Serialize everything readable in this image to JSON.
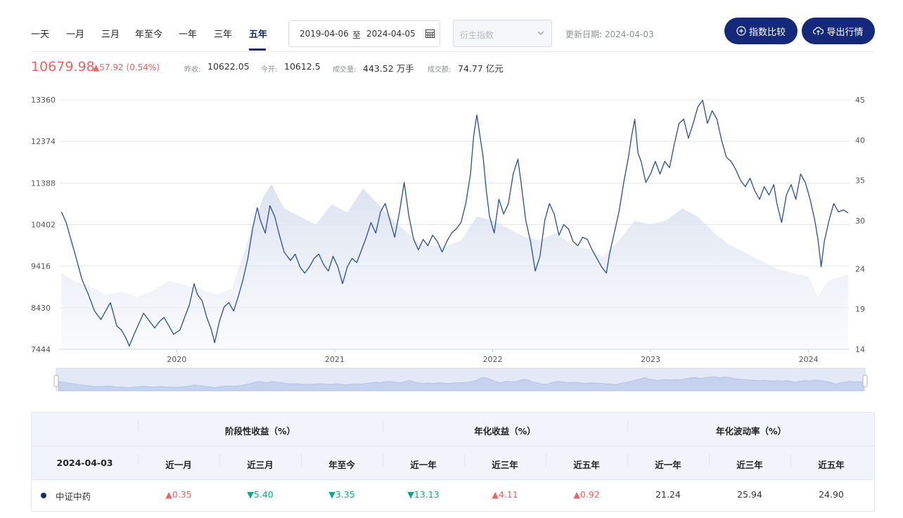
{
  "toolbar": {
    "periods": [
      "一天",
      "一月",
      "三月",
      "年至今",
      "一年",
      "三年",
      "五年"
    ],
    "active_period": "五年",
    "date_start": "2019-04-06",
    "date_sep": "至",
    "date_end": "2024-04-05",
    "derived_placeholder": "衍生指数",
    "update_label": "更新日期: 2024-04-03",
    "compare_button": "指数比较",
    "export_button": "导出行情"
  },
  "quote": {
    "price": "10679.98",
    "change": "▲57.92 (0.54%)",
    "prev_close_label": "昨收:",
    "prev_close": "10622.05",
    "open_label": "今开:",
    "open": "10612.5",
    "volume_label": "成交量:",
    "volume": "443.52 万手",
    "amount_label": "成交额:",
    "amount": "74.77 亿元"
  },
  "chart_data": {
    "type": "line",
    "x_ticks": [
      "2020",
      "2021",
      "2022",
      "2023",
      "2024"
    ],
    "y_left_ticks": [
      7444,
      8430,
      9416,
      10402,
      11388,
      12374,
      13360
    ],
    "y_left_range": [
      7444,
      13360
    ],
    "y_right_ticks": [
      14,
      19,
      24,
      30,
      35,
      40,
      45
    ],
    "y_right_range": [
      14,
      45
    ],
    "series": [
      {
        "kind": "line",
        "color": "#2a4e9c",
        "points": [
          [
            2019.27,
            10700
          ],
          [
            2019.3,
            10450
          ],
          [
            2019.33,
            10050
          ],
          [
            2019.36,
            9650
          ],
          [
            2019.4,
            9100
          ],
          [
            2019.44,
            8750
          ],
          [
            2019.48,
            8350
          ],
          [
            2019.52,
            8150
          ],
          [
            2019.55,
            8350
          ],
          [
            2019.58,
            8550
          ],
          [
            2019.62,
            8000
          ],
          [
            2019.65,
            7900
          ],
          [
            2019.68,
            7700
          ],
          [
            2019.7,
            7520
          ],
          [
            2019.73,
            7800
          ],
          [
            2019.76,
            8050
          ],
          [
            2019.79,
            8300
          ],
          [
            2019.82,
            8150
          ],
          [
            2019.86,
            7950
          ],
          [
            2019.89,
            8100
          ],
          [
            2019.92,
            8200
          ],
          [
            2019.95,
            8000
          ],
          [
            2019.98,
            7800
          ],
          [
            2020.02,
            7900
          ],
          [
            2020.05,
            8200
          ],
          [
            2020.08,
            8500
          ],
          [
            2020.11,
            9000
          ],
          [
            2020.13,
            8750
          ],
          [
            2020.16,
            8600
          ],
          [
            2020.19,
            8200
          ],
          [
            2020.22,
            7900
          ],
          [
            2020.24,
            7600
          ],
          [
            2020.27,
            8100
          ],
          [
            2020.3,
            8450
          ],
          [
            2020.33,
            8550
          ],
          [
            2020.36,
            8350
          ],
          [
            2020.39,
            8700
          ],
          [
            2020.42,
            9100
          ],
          [
            2020.45,
            9600
          ],
          [
            2020.48,
            10300
          ],
          [
            2020.51,
            10800
          ],
          [
            2020.53,
            10500
          ],
          [
            2020.56,
            10200
          ],
          [
            2020.59,
            10850
          ],
          [
            2020.62,
            10600
          ],
          [
            2020.65,
            10150
          ],
          [
            2020.68,
            9750
          ],
          [
            2020.72,
            9550
          ],
          [
            2020.75,
            9700
          ],
          [
            2020.78,
            9400
          ],
          [
            2020.81,
            9250
          ],
          [
            2020.84,
            9400
          ],
          [
            2020.87,
            9600
          ],
          [
            2020.9,
            9700
          ],
          [
            2020.93,
            9450
          ],
          [
            2020.96,
            9300
          ],
          [
            2020.99,
            9650
          ],
          [
            2021.02,
            9400
          ],
          [
            2021.05,
            9000
          ],
          [
            2021.08,
            9400
          ],
          [
            2021.11,
            9600
          ],
          [
            2021.14,
            9500
          ],
          [
            2021.17,
            9800
          ],
          [
            2021.2,
            10100
          ],
          [
            2021.23,
            10450
          ],
          [
            2021.26,
            10200
          ],
          [
            2021.29,
            10700
          ],
          [
            2021.32,
            10900
          ],
          [
            2021.35,
            10500
          ],
          [
            2021.38,
            10100
          ],
          [
            2021.41,
            10700
          ],
          [
            2021.44,
            11400
          ],
          [
            2021.47,
            10600
          ],
          [
            2021.5,
            10050
          ],
          [
            2021.53,
            9800
          ],
          [
            2021.56,
            10050
          ],
          [
            2021.59,
            9900
          ],
          [
            2021.62,
            10150
          ],
          [
            2021.65,
            10000
          ],
          [
            2021.68,
            9750
          ],
          [
            2021.71,
            10000
          ],
          [
            2021.74,
            10200
          ],
          [
            2021.77,
            10300
          ],
          [
            2021.8,
            10450
          ],
          [
            2021.83,
            10900
          ],
          [
            2021.86,
            11600
          ],
          [
            2021.88,
            12500
          ],
          [
            2021.9,
            13000
          ],
          [
            2021.92,
            12500
          ],
          [
            2021.94,
            12000
          ],
          [
            2021.96,
            11200
          ],
          [
            2021.98,
            10600
          ],
          [
            2022.01,
            10200
          ],
          [
            2022.04,
            11000
          ],
          [
            2022.07,
            10650
          ],
          [
            2022.1,
            10900
          ],
          [
            2022.13,
            11600
          ],
          [
            2022.16,
            11950
          ],
          [
            2022.18,
            11400
          ],
          [
            2022.21,
            10500
          ],
          [
            2022.24,
            10000
          ],
          [
            2022.27,
            9300
          ],
          [
            2022.3,
            9650
          ],
          [
            2022.33,
            10500
          ],
          [
            2022.36,
            10900
          ],
          [
            2022.39,
            10650
          ],
          [
            2022.42,
            10150
          ],
          [
            2022.45,
            10400
          ],
          [
            2022.48,
            10300
          ],
          [
            2022.51,
            10000
          ],
          [
            2022.54,
            9900
          ],
          [
            2022.57,
            10100
          ],
          [
            2022.6,
            10050
          ],
          [
            2022.63,
            9800
          ],
          [
            2022.66,
            9600
          ],
          [
            2022.69,
            9400
          ],
          [
            2022.72,
            9250
          ],
          [
            2022.74,
            9700
          ],
          [
            2022.77,
            10200
          ],
          [
            2022.8,
            10700
          ],
          [
            2022.83,
            11400
          ],
          [
            2022.86,
            12000
          ],
          [
            2022.88,
            12500
          ],
          [
            2022.9,
            12900
          ],
          [
            2022.92,
            12100
          ],
          [
            2022.94,
            11900
          ],
          [
            2022.97,
            11400
          ],
          [
            2023.0,
            11600
          ],
          [
            2023.03,
            11900
          ],
          [
            2023.06,
            11600
          ],
          [
            2023.09,
            11900
          ],
          [
            2023.12,
            11750
          ],
          [
            2023.15,
            12300
          ],
          [
            2023.18,
            12800
          ],
          [
            2023.21,
            12900
          ],
          [
            2023.24,
            12450
          ],
          [
            2023.27,
            12800
          ],
          [
            2023.3,
            13200
          ],
          [
            2023.33,
            13350
          ],
          [
            2023.36,
            12800
          ],
          [
            2023.39,
            13100
          ],
          [
            2023.42,
            12900
          ],
          [
            2023.45,
            12400
          ],
          [
            2023.48,
            12000
          ],
          [
            2023.51,
            11900
          ],
          [
            2023.54,
            11700
          ],
          [
            2023.57,
            11450
          ],
          [
            2023.6,
            11300
          ],
          [
            2023.63,
            11500
          ],
          [
            2023.66,
            11200
          ],
          [
            2023.69,
            11000
          ],
          [
            2023.72,
            11300
          ],
          [
            2023.75,
            11100
          ],
          [
            2023.78,
            11350
          ],
          [
            2023.8,
            10900
          ],
          [
            2023.83,
            10450
          ],
          [
            2023.86,
            11100
          ],
          [
            2023.89,
            11350
          ],
          [
            2023.92,
            11000
          ],
          [
            2023.95,
            11600
          ],
          [
            2023.98,
            11400
          ],
          [
            2024.01,
            11000
          ],
          [
            2024.04,
            10500
          ],
          [
            2024.06,
            10050
          ],
          [
            2024.08,
            9400
          ],
          [
            2024.1,
            10000
          ],
          [
            2024.13,
            10500
          ],
          [
            2024.16,
            10900
          ],
          [
            2024.19,
            10700
          ],
          [
            2024.22,
            10750
          ],
          [
            2024.25,
            10680
          ]
        ]
      },
      {
        "kind": "area",
        "axis": "right",
        "color": "#dfe5f1",
        "points": [
          [
            2019.27,
            23.5
          ],
          [
            2019.35,
            22.5
          ],
          [
            2019.45,
            21.8
          ],
          [
            2019.55,
            20.8
          ],
          [
            2019.65,
            21.2
          ],
          [
            2019.75,
            20.5
          ],
          [
            2019.85,
            21.3
          ],
          [
            2019.95,
            22.5
          ],
          [
            2020.05,
            22.0
          ],
          [
            2020.15,
            21.5
          ],
          [
            2020.25,
            20.8
          ],
          [
            2020.35,
            21.6
          ],
          [
            2020.45,
            27.5
          ],
          [
            2020.55,
            33.0
          ],
          [
            2020.6,
            34.5
          ],
          [
            2020.68,
            31.5
          ],
          [
            2020.78,
            30.5
          ],
          [
            2020.88,
            29.5
          ],
          [
            2020.98,
            32.0
          ],
          [
            2021.08,
            31.0
          ],
          [
            2021.18,
            34.0
          ],
          [
            2021.3,
            31.5
          ],
          [
            2021.4,
            29.5
          ],
          [
            2021.55,
            27.0
          ],
          [
            2021.7,
            26.8
          ],
          [
            2021.8,
            27.5
          ],
          [
            2021.9,
            30.5
          ],
          [
            2022.0,
            30.0
          ],
          [
            2022.1,
            29.0
          ],
          [
            2022.2,
            28.0
          ],
          [
            2022.3,
            27.5
          ],
          [
            2022.4,
            28.5
          ],
          [
            2022.5,
            27.0
          ],
          [
            2022.6,
            26.5
          ],
          [
            2022.7,
            25.5
          ],
          [
            2022.8,
            27.5
          ],
          [
            2022.9,
            30.0
          ],
          [
            2023.0,
            29.5
          ],
          [
            2023.1,
            30.0
          ],
          [
            2023.2,
            31.5
          ],
          [
            2023.3,
            30.5
          ],
          [
            2023.4,
            28.5
          ],
          [
            2023.5,
            27.0
          ],
          [
            2023.6,
            26.0
          ],
          [
            2023.7,
            25.0
          ],
          [
            2023.8,
            24.0
          ],
          [
            2023.9,
            23.5
          ],
          [
            2024.0,
            23.0
          ],
          [
            2024.06,
            20.5
          ],
          [
            2024.12,
            22.5
          ],
          [
            2024.2,
            23.0
          ],
          [
            2024.25,
            23.3
          ]
        ]
      }
    ]
  },
  "table": {
    "date_label": "2024-04-03",
    "groups": [
      "阶段性收益（%）",
      "年化收益（%）",
      "年化波动率（%）"
    ],
    "columns": [
      "近一月",
      "近三月",
      "年至今",
      "近一年",
      "近三年",
      "近五年",
      "近一年",
      "近三年",
      "近五年"
    ],
    "row": {
      "name": "中证中药",
      "cells": [
        {
          "text": "▲0.35",
          "dir": "up"
        },
        {
          "text": "▼5.40",
          "dir": "down"
        },
        {
          "text": "▼3.35",
          "dir": "down"
        },
        {
          "text": "▼13.13",
          "dir": "down"
        },
        {
          "text": "▲4.11",
          "dir": "up"
        },
        {
          "text": "▲0.92",
          "dir": "up"
        },
        {
          "text": "21.24",
          "dir": "none"
        },
        {
          "text": "25.94",
          "dir": "none"
        },
        {
          "text": "24.90",
          "dir": "none"
        }
      ]
    }
  }
}
